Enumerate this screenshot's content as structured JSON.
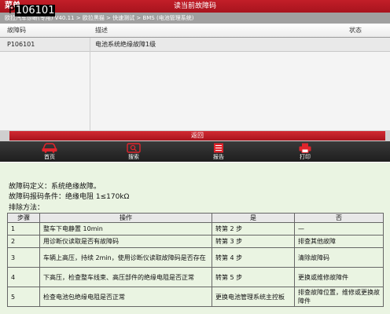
{
  "screen": {
    "topbar": {
      "menu_label": "菜单",
      "title": "读当前故障码"
    },
    "breadcrumb": "欧拉汽车诊断(专用) V40.11 > 欧拉黑猫 > 快速测试 > BMS (电池管理系统)",
    "table": {
      "headers": {
        "code": "故障码",
        "description": "描述",
        "status": "状态"
      },
      "rows": [
        {
          "code": "P106101",
          "description": "电池系统绝缘故障1级",
          "status": ""
        }
      ]
    },
    "back_label": "返回",
    "nav": [
      {
        "label": "首页",
        "icon": "car-icon"
      },
      {
        "label": "搜索",
        "icon": "search-icon"
      },
      {
        "label": "报告",
        "icon": "report-icon"
      },
      {
        "label": "打印",
        "icon": "printer-icon"
      }
    ]
  },
  "doc": {
    "code_prefix": "P",
    "code_number": "106101",
    "definition": "故障码定义：系统绝缘故障。",
    "condition": "故障码报码条件：绝缘电阻 1≤170kΩ",
    "method_title": "排除方法：",
    "headers": {
      "step": "步骤",
      "operation": "操作",
      "yes": "是",
      "no": "否"
    },
    "steps": [
      {
        "step": "1",
        "operation": "整车下电静置 10min",
        "yes": "转第 2 步",
        "no": "—"
      },
      {
        "step": "2",
        "operation": "用诊断仪读取是否有故障码",
        "yes": "转第 3 步",
        "no": "排查其他故障"
      },
      {
        "step": "3",
        "operation": "车辆上高压，持续 2min，使用诊断仪读取故障码是否存在",
        "yes": "转第 4 步",
        "no": "清除故障码"
      },
      {
        "step": "4",
        "operation": "下高压，检查整车线束、高压部件的绝缘电阻是否正常",
        "yes": "转第 5 步",
        "no": "更换或维修故障件"
      },
      {
        "step": "5",
        "operation": "检查电池包绝缘电阻是否正常",
        "yes": "更换电池管理系统主控板",
        "no": "排查故障位置，维修或更换故障件"
      }
    ]
  }
}
